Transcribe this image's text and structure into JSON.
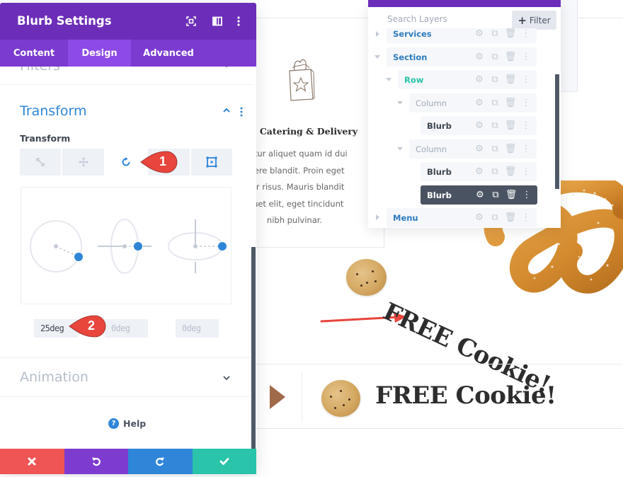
{
  "panel": {
    "title": "Blurb Settings",
    "header_icons": [
      "fullscreen-icon",
      "split-view-icon",
      "more-options-icon"
    ],
    "tabs": [
      {
        "label": "Content",
        "active": false
      },
      {
        "label": "Design",
        "active": true
      },
      {
        "label": "Advanced",
        "active": false
      }
    ],
    "filters_section": "Filters",
    "transform_section": {
      "title": "Transform",
      "field_label": "Transform",
      "modes": [
        {
          "name": "scale",
          "icon": "scale-arrows-icon",
          "active": false
        },
        {
          "name": "translate",
          "icon": "move-icon",
          "active": false
        },
        {
          "name": "rotate",
          "icon": "rotate-icon",
          "active": true
        },
        {
          "name": "skew",
          "icon": "skew-icon",
          "active": false
        },
        {
          "name": "origin",
          "icon": "transform-origin-icon",
          "active": false
        }
      ],
      "rotate_values": {
        "z": "25deg",
        "x": "0deg",
        "y": "0deg"
      }
    },
    "animation_section": "Animation",
    "help_label": "Help",
    "footer": {
      "cancel": "close-icon",
      "undo": "undo-icon",
      "redo": "redo-icon",
      "save": "check-icon"
    },
    "colors": {
      "header": "#6c2eb9",
      "tabs": "#7b3ad0",
      "active_tab": "#8e4ae6",
      "accent_blue": "#2f86d8",
      "cancel": "#ef5555",
      "undo": "#7e3bd0",
      "redo": "#2f86d8",
      "save": "#29c4a9"
    }
  },
  "callouts": [
    {
      "number": "1",
      "color": "#e8453c"
    },
    {
      "number": "2",
      "color": "#e8453c"
    }
  ],
  "layers": {
    "search_placeholder": "Search Layers",
    "filter_label": "Filter",
    "items": [
      {
        "label": "Services",
        "type": "section",
        "depth": 0,
        "expanded": false,
        "active": false
      },
      {
        "label": "Section",
        "type": "section",
        "depth": 0,
        "expanded": true,
        "active": false
      },
      {
        "label": "Row",
        "type": "row",
        "depth": 1,
        "expanded": true,
        "active": false
      },
      {
        "label": "Column",
        "type": "column",
        "depth": 2,
        "expanded": true,
        "active": false
      },
      {
        "label": "Blurb",
        "type": "module",
        "depth": 3,
        "active": false
      },
      {
        "label": "Column",
        "type": "column",
        "depth": 2,
        "expanded": true,
        "active": false
      },
      {
        "label": "Blurb",
        "type": "module",
        "depth": 3,
        "active": false
      },
      {
        "label": "Blurb",
        "type": "module",
        "depth": 3,
        "active": true
      },
      {
        "label": "Menu",
        "type": "section",
        "depth": 0,
        "expanded": false,
        "active": false
      }
    ]
  },
  "page": {
    "blurb": {
      "title": "Catering & Delivery",
      "text": "abitur aliquet quam id dui\nsuere blandit. Proin eget\nrtor risus. Mauris blandit\niquet elit, eget tincidunt\nnibh pulvinar."
    },
    "rotated_heading": "FREE Cookie!",
    "rotation_deg": 25,
    "normal_heading": "FREE Cookie!"
  }
}
